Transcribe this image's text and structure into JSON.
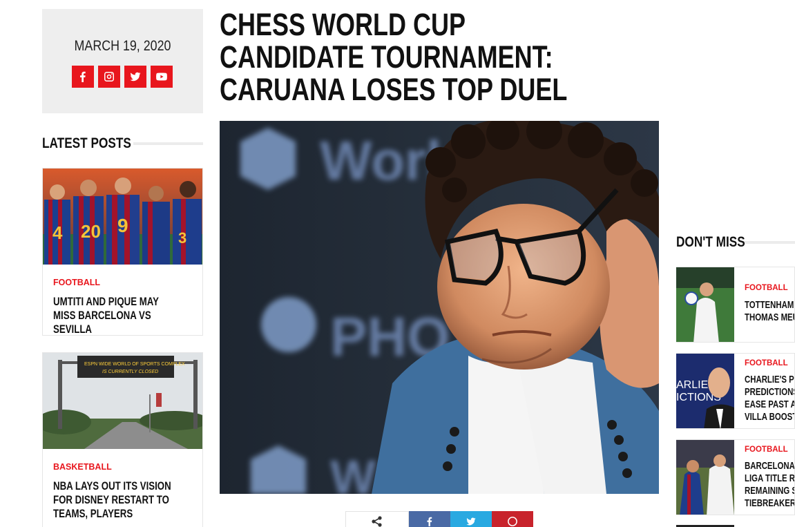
{
  "sidebar_left": {
    "date": "MARCH 19, 2020",
    "social": [
      {
        "name": "facebook",
        "icon": "facebook-icon"
      },
      {
        "name": "instagram",
        "icon": "instagram-icon"
      },
      {
        "name": "twitter",
        "icon": "twitter-icon"
      },
      {
        "name": "youtube",
        "icon": "youtube-icon"
      }
    ],
    "latest_heading": "LATEST POSTS",
    "posts": [
      {
        "category": "FOOTBALL",
        "title": "UMTITI AND PIQUE MAY MISS BARCELONA VS SEVILLA"
      },
      {
        "category": "BASKETBALL",
        "title": "NBA LAYS OUT ITS VISION FOR DISNEY RESTART TO TEAMS, PLAYERS"
      }
    ],
    "post2_sign_line1": "ESPN WIDE WORLD OF SPORTS COMPLEX",
    "post2_sign_line2": "IS CURRENTLY CLOSED"
  },
  "article": {
    "title": "CHESS WORLD CUP CANDIDATE TOURNAMENT: CARUANA LOSES TOP DUEL"
  },
  "sidebar_right": {
    "heading": "DON'T MISS",
    "items": [
      {
        "category": "FOOTBALL",
        "title_lines": [
          "TOTTENHAM I",
          "THOMAS MEU"
        ]
      },
      {
        "category": "FOOTBALL",
        "title_lines": [
          "CHARLIE'S PR",
          "PREDICTIONS",
          "EASE PAST AR",
          "VILLA BOOST?"
        ],
        "thumb_text": [
          "ARLIE'S",
          "ICTIONS"
        ]
      },
      {
        "category": "FOOTBALL",
        "title_lines": [
          "BARCELONA-I",
          "LIGA TITLE RA",
          "REMAINING S",
          "TIEBREAKER"
        ]
      }
    ]
  },
  "colors": {
    "accent": "#e8161d",
    "facebook": "#4a6aa5",
    "twitter": "#29a9e1",
    "pinterest": "#c8232c"
  }
}
